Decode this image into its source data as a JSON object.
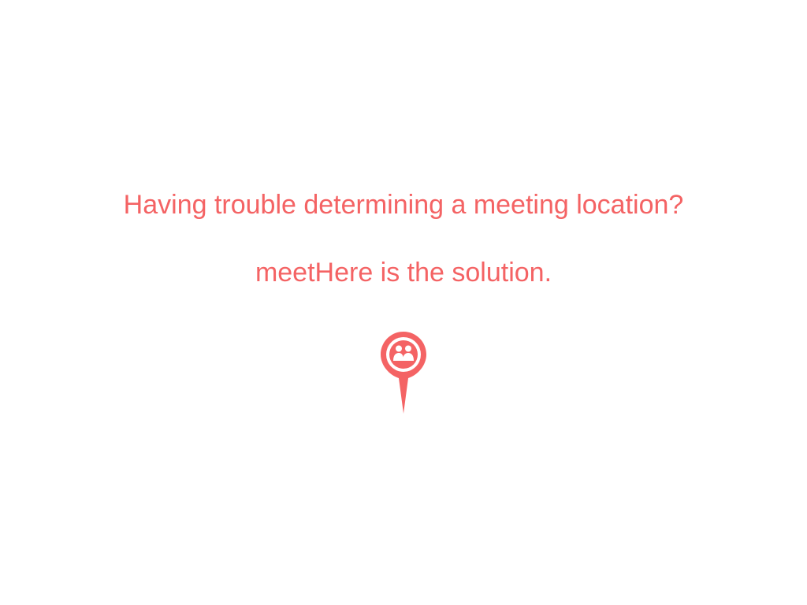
{
  "slide": {
    "question": "Having trouble determining a meeting location?",
    "answer": "meetHere is the solution."
  },
  "logo": {
    "icon": "map-pin-people-icon",
    "color": "#f46364"
  },
  "theme": {
    "text_color": "#f46364",
    "background": "#ffffff"
  }
}
